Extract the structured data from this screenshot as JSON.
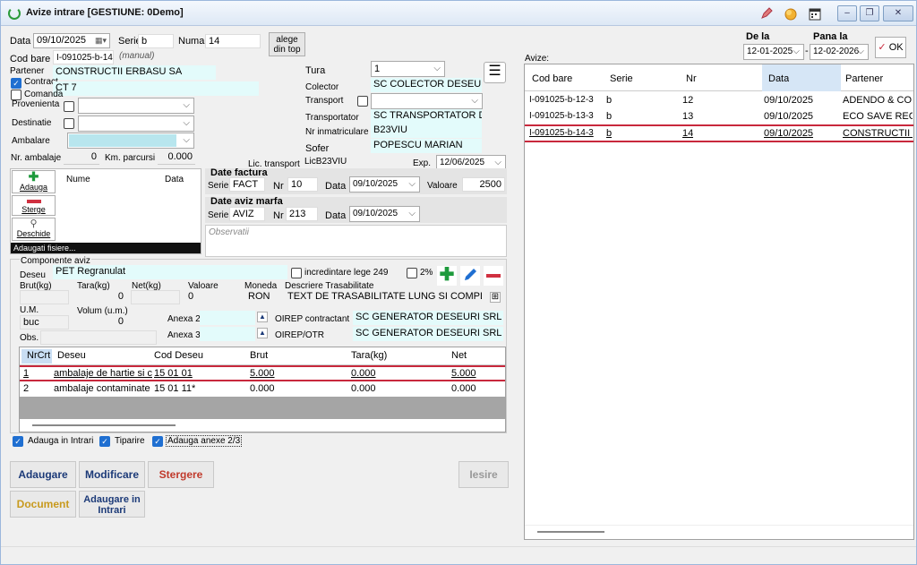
{
  "window": {
    "title": "Avize intrare [GESTIUNE: 0Demo]",
    "minimize": "–",
    "maximize": "❐",
    "close": "✕"
  },
  "form": {
    "data_label": "Data",
    "data_value": "09/10/2025",
    "serie_label": "Serie",
    "serie_value": "b",
    "numar_label": "Numar",
    "numar_value": "14",
    "alege_btn_line1": "alege",
    "alege_btn_line2": "din top",
    "cod_bare_label": "Cod bare",
    "cod_bare_value": "I-091025-b-14-",
    "manual_note": "(manual)",
    "partener_label": "Partener",
    "partener_value": "CONSTRUCTII ERBASU SA",
    "contract_label": "Contract",
    "contract_value": "CT 7",
    "comanda_label": "Comanda",
    "provenienta_label": "Provenienta",
    "destinatie_label": "Destinatie",
    "ambalare_label": "Ambalare",
    "nr_ambalaje_label": "Nr. ambalaje",
    "nr_ambalaje_value": "0",
    "km_label": "Km. parcursi",
    "km_value": "0.000",
    "tura_label": "Tura",
    "tura_value": "1",
    "colector_label": "Colector",
    "colector_value": "SC COLECTOR DESEURI S",
    "transport_label": "Transport",
    "transportator_label": "Transportator",
    "transportator_value": "SC TRANSPORTATOR DES",
    "nr_inmatriculare_label": "Nr inmatriculare",
    "nr_inmatriculare_value": "B23VIU",
    "sofer_label": "Sofer",
    "sofer_value": "POPESCU MARIAN",
    "lic_transport_label": "Lic. transport",
    "lic_transport_value": "LicB23VIU",
    "exp_label": "Exp.",
    "exp_value": "12/06/2025"
  },
  "files": {
    "adauga": "Adauga",
    "sterge": "Sterge",
    "deschide": "Deschide",
    "col_nume": "Nume",
    "col_data": "Data",
    "footer": "Adaugati fisiere..."
  },
  "factura": {
    "title": "Date factura",
    "serie_label": "Serie",
    "serie_value": "FACT",
    "nr_label": "Nr",
    "nr_value": "10",
    "data_label": "Data",
    "data_value": "09/10/2025",
    "valoare_label": "Valoare",
    "valoare_value": "2500"
  },
  "aviz_marfa": {
    "title": "Date aviz marfa",
    "serie_label": "Serie",
    "serie_value": "AVIZ",
    "nr_label": "Nr",
    "nr_value": "213",
    "data_label": "Data",
    "data_value": "09/10/2025",
    "observatii_placeholder": "Observatii"
  },
  "componente": {
    "title": "Componente aviz",
    "deseu_label": "Deseu",
    "deseu_value": "PET Regranulat",
    "incredintare_label": "incredintare lege 249",
    "pct_label": "2%",
    "brut_label": "Brut(kg)",
    "tara_label": "Tara(kg)",
    "net_label": "Net(kg)",
    "valoare_label": "Valoare",
    "moneda_label": "Moneda",
    "descriere_label": "Descriere Trasabilitate",
    "tara_value": "0",
    "valoare_value": "0",
    "moneda_value": "RON",
    "descriere_value": "TEXT DE TRASABILITATE LUNG SI COMPLICAT",
    "um_label": "U.M.",
    "um_value": "buc",
    "volum_label": "Volum (u.m.)",
    "volum_value": "0",
    "anexa2_label": "Anexa 2",
    "anexa3_label": "Anexa 3",
    "oirep_contractant_label": "OIREP contractant",
    "oirep_contractant_value": "SC GENERATOR DESEURI SRL",
    "oirep_otr_label": "OIREP/OTR",
    "oirep_otr_value": "SC GENERATOR DESEURI SRL",
    "obs_label": "Obs.",
    "table_headers": [
      "NrCrt",
      "Deseu",
      "Cod Deseu",
      "Brut",
      "Tara(kg)",
      "Net"
    ],
    "rows": [
      [
        "1",
        "ambalaje de hartie si c...",
        "15 01 01",
        "5.000",
        "0.000",
        "5.000"
      ],
      [
        "2",
        "ambalaje contaminate",
        "15 01 11*",
        "0.000",
        "0.000",
        "0.000"
      ]
    ]
  },
  "options": {
    "adauga_intrari": "Adauga in Intrari",
    "tiparire": "Tiparire",
    "adauga_anexe": "Adauga anexe 2/3"
  },
  "actions": {
    "adaugare": "Adaugare",
    "modificare": "Modificare",
    "stergere": "Stergere",
    "iesire": "Iesire",
    "document": "Document",
    "adaugare_intrari_line1": "Adaugare in",
    "adaugare_intrari_line2": "Intrari"
  },
  "filter": {
    "de_la_label": "De la",
    "de_la_value": "12-01-2025",
    "pana_la_label": "Pana la",
    "pana_la_value": "12-02-2026",
    "dash": "-",
    "ok": "OK",
    "avize_label": "Avize:"
  },
  "avize_table": {
    "headers": [
      "Cod bare",
      "Serie",
      "Nr",
      "Data",
      "Partener"
    ],
    "rows": [
      [
        "I-091025-b-12-3",
        "b",
        "12",
        "09/10/2025",
        "ADENDO & CO S..."
      ],
      [
        "I-091025-b-13-3",
        "b",
        "13",
        "09/10/2025",
        "ECO SAVE REC..."
      ],
      [
        "I-091025-b-14-3",
        "b",
        "14",
        "09/10/2025",
        "CONSTRUCTII E..."
      ]
    ]
  },
  "colors": {
    "accent": "#1f6fd1",
    "cyan_field": "#e3fbfb",
    "selected_row_border": "#c8283c",
    "green_add": "#1e9a3c",
    "red_delete": "#d03040",
    "stergere_text": "#c0392b",
    "button_text_blue": "#1c3a78",
    "document_text": "#c89a1e"
  }
}
